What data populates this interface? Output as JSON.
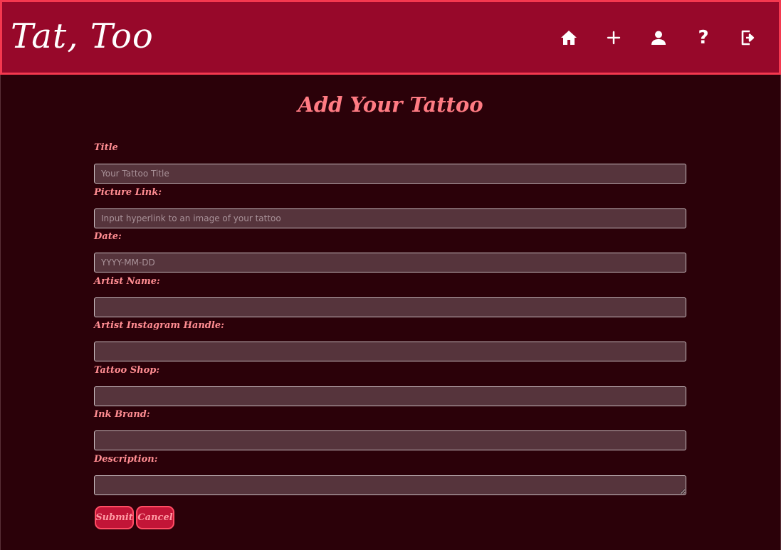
{
  "brand": "Tat, Too",
  "nav": {
    "icons": [
      "home-icon",
      "plus-icon",
      "person-icon",
      "help-icon",
      "logout-icon"
    ],
    "help_glyph": "?"
  },
  "form": {
    "title": "Add Your Tattoo",
    "fields": [
      {
        "label": "Title",
        "placeholder": "Your Tattoo Title",
        "value": ""
      },
      {
        "label": "Picture Link:",
        "placeholder": "Input hyperlink to an image of your tattoo",
        "value": ""
      },
      {
        "label": "Date:",
        "placeholder": "YYYY-MM-DD",
        "value": ""
      },
      {
        "label": "Artist Name:",
        "placeholder": "",
        "value": ""
      },
      {
        "label": "Artist Instagram Handle:",
        "placeholder": "",
        "value": ""
      },
      {
        "label": "Tattoo Shop:",
        "placeholder": "",
        "value": ""
      },
      {
        "label": "Ink Brand:",
        "placeholder": "",
        "value": ""
      },
      {
        "label": "Description:",
        "placeholder": "",
        "value": ""
      }
    ],
    "submit_label": "Submit",
    "cancel_label": "Cancel"
  },
  "colors": {
    "navbar": "#97082a",
    "navbar_border": "#f5384f",
    "background": "#2b0109",
    "label": "#ff8d92",
    "heading": "#ff7b83",
    "input_bg": "#56343c",
    "button_bg": "#c21537"
  }
}
